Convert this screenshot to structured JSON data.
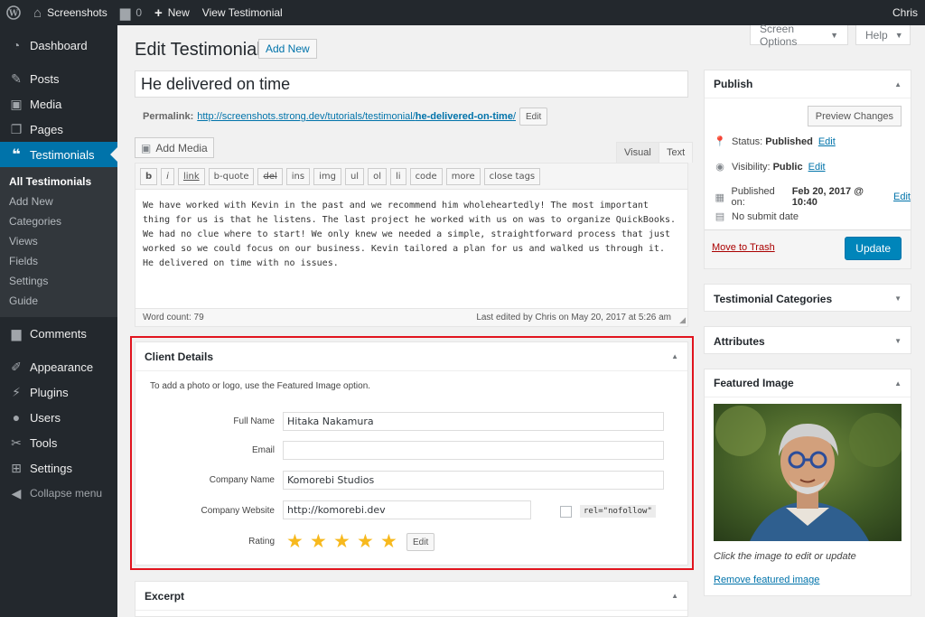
{
  "adminbar": {
    "site_name": "Screenshots",
    "comments_count": "0",
    "new_label": "New",
    "view_label": "View Testimonial",
    "user": "Chris"
  },
  "sidebar": {
    "items": [
      {
        "label": "Dashboard",
        "icon": "dashboard-icon"
      },
      {
        "label": "Posts",
        "icon": "pin-icon"
      },
      {
        "label": "Media",
        "icon": "media-icon"
      },
      {
        "label": "Pages",
        "icon": "pages-icon"
      },
      {
        "label": "Testimonials",
        "icon": "quote-icon"
      },
      {
        "label": "Comments",
        "icon": "comment-icon"
      },
      {
        "label": "Appearance",
        "icon": "brush-icon"
      },
      {
        "label": "Plugins",
        "icon": "plugin-icon"
      },
      {
        "label": "Users",
        "icon": "users-icon"
      },
      {
        "label": "Tools",
        "icon": "wrench-icon"
      },
      {
        "label": "Settings",
        "icon": "settings-icon"
      }
    ],
    "submenu": [
      "All Testimonials",
      "Add New",
      "Categories",
      "Views",
      "Fields",
      "Settings",
      "Guide"
    ],
    "collapse_label": "Collapse menu"
  },
  "screen_options": "Screen Options",
  "help": "Help",
  "page_title": "Edit Testimonial",
  "add_new": "Add New",
  "post_title": "He delivered on time",
  "permalink": {
    "label": "Permalink:",
    "base": "http://screenshots.strong.dev/tutorials/testimonial/",
    "slug": "he-delivered-on-time",
    "trailing": "/",
    "edit": "Edit"
  },
  "editor": {
    "add_media": "Add Media",
    "tab_visual": "Visual",
    "tab_text": "Text",
    "quicktags": [
      "b",
      "i",
      "link",
      "b-quote",
      "del",
      "ins",
      "img",
      "ul",
      "ol",
      "li",
      "code",
      "more",
      "close tags"
    ],
    "content": "We have worked with Kevin in the past and we recommend him wholeheartedly! The most important thing for us is that he listens. The last project he worked with us on was to organize QuickBooks. We had no clue where to start! We only knew we needed a simple, straightforward process that just worked so we could focus on our business. Kevin tailored a plan for us and walked us through it. He delivered on time with no issues.",
    "word_count": "Word count: 79",
    "last_edited": "Last edited by Chris on May 20, 2017 at 5:26 am"
  },
  "client_details": {
    "title": "Client Details",
    "note": "To add a photo or logo, use the Featured Image option.",
    "full_name_label": "Full Name",
    "full_name": "Hitaka Nakamura",
    "email_label": "Email",
    "email": "",
    "company_name_label": "Company Name",
    "company_name": "Komorebi Studios",
    "company_website_label": "Company Website",
    "company_website": "http://komorebi.dev",
    "nofollow": "rel=\"nofollow\"",
    "rating_label": "Rating",
    "rating": 5,
    "rating_max": 5,
    "edit": "Edit",
    "star_color": "#f7b91e"
  },
  "excerpt": {
    "title": "Excerpt"
  },
  "publish": {
    "title": "Publish",
    "preview": "Preview Changes",
    "status_label": "Status:",
    "status": "Published",
    "visibility_label": "Visibility:",
    "visibility": "Public",
    "published_label": "Published on:",
    "published_on": "Feb 20, 2017 @ 10:40",
    "submit_date": "No submit date",
    "edit": "Edit",
    "trash": "Move to Trash",
    "update": "Update"
  },
  "categories_box": {
    "title": "Testimonial Categories"
  },
  "attributes_box": {
    "title": "Attributes"
  },
  "featured_image": {
    "title": "Featured Image",
    "caption": "Click the image to edit or update",
    "remove": "Remove featured image"
  },
  "colors": {
    "admin_bar": "#23282d",
    "accent": "#0073aa",
    "highlight_border": "#e1141e",
    "update_button": "#0085ba"
  }
}
